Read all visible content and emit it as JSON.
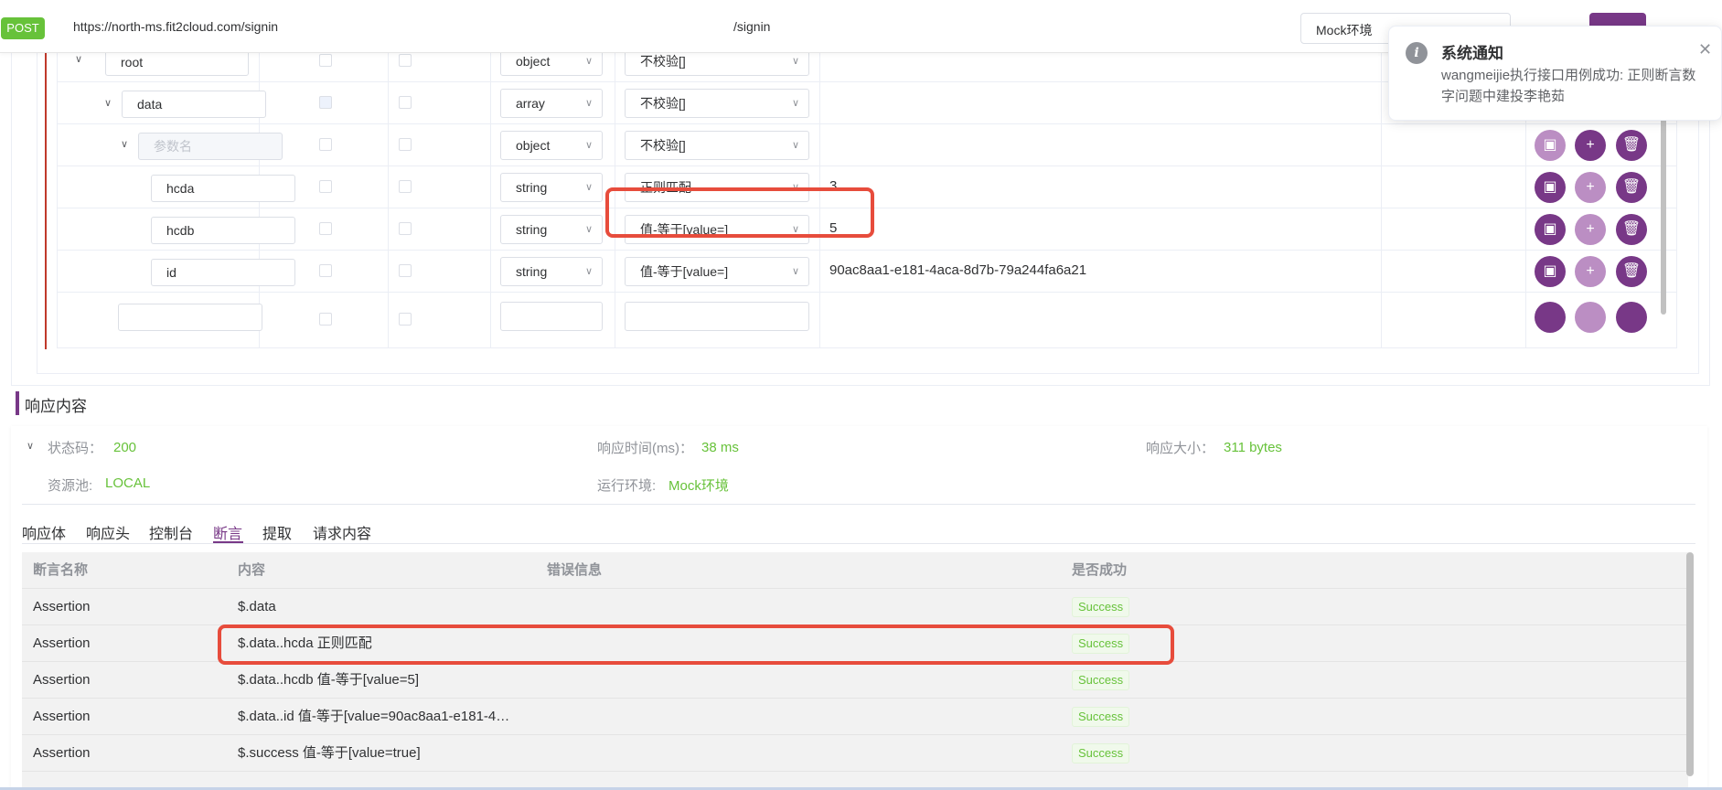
{
  "topbar": {
    "method": "POST",
    "url": "https://north-ms.fit2cloud.com/signin",
    "path": "/signin",
    "environment": "Mock环境"
  },
  "json_rows": [
    {
      "name": "root",
      "type": "object",
      "rule": "不校验[]",
      "value": "",
      "placeholder": false
    },
    {
      "name": "data",
      "type": "array",
      "rule": "不校验[]",
      "value": "",
      "placeholder": false
    },
    {
      "name": "参数名",
      "type": "object",
      "rule": "不校验[]",
      "value": "",
      "placeholder": true
    },
    {
      "name": "hcda",
      "type": "string",
      "rule": "正则匹配",
      "value": "3",
      "placeholder": false
    },
    {
      "name": "hcdb",
      "type": "string",
      "rule": "值-等于[value=]",
      "value": "5",
      "placeholder": false
    },
    {
      "name": "id",
      "type": "string",
      "rule": "值-等于[value=]",
      "value": "90ac8aa1-e181-4aca-8d7b-79a244fa6a21",
      "placeholder": false
    }
  ],
  "notification": {
    "title": "系统通知",
    "message": "wangmeijie执行接口用例成功: 正则断言数字问题中建投李艳茹"
  },
  "response": {
    "section_title": "响应内容",
    "status_label": "状态码：",
    "status_value": "200",
    "time_label": "响应时间(ms)：",
    "time_value": "38 ms",
    "size_label": "响应大小：",
    "size_value": "311 bytes",
    "pool_label": "资源池:",
    "pool_value": "LOCAL",
    "env_label": "运行环境:",
    "env_value": "Mock环境",
    "tabs": [
      "响应体",
      "响应头",
      "控制台",
      "断言",
      "提取",
      "请求内容"
    ],
    "active_tab": "断言"
  },
  "assertions": {
    "headers": {
      "name": "断言名称",
      "content": "内容",
      "error": "错误信息",
      "success": "是否成功"
    },
    "rows": [
      {
        "name": "Assertion",
        "content": "$.data",
        "error": "",
        "result": "Success"
      },
      {
        "name": "Assertion",
        "content": "$.data..hcda 正则匹配",
        "error": "",
        "result": "Success"
      },
      {
        "name": "Assertion",
        "content": "$.data..hcdb 值-等于[value=5]",
        "error": "",
        "result": "Success"
      },
      {
        "name": "Assertion",
        "content": "$.data..id 值-等于[value=90ac8aa1-e181-4…",
        "error": "",
        "result": "Success"
      },
      {
        "name": "Assertion",
        "content": "$.success 值-等于[value=true]",
        "error": "",
        "result": "Success"
      }
    ]
  },
  "colors": {
    "brand": "#783887",
    "success": "#67c23a",
    "highlight": "#e74c3c"
  }
}
